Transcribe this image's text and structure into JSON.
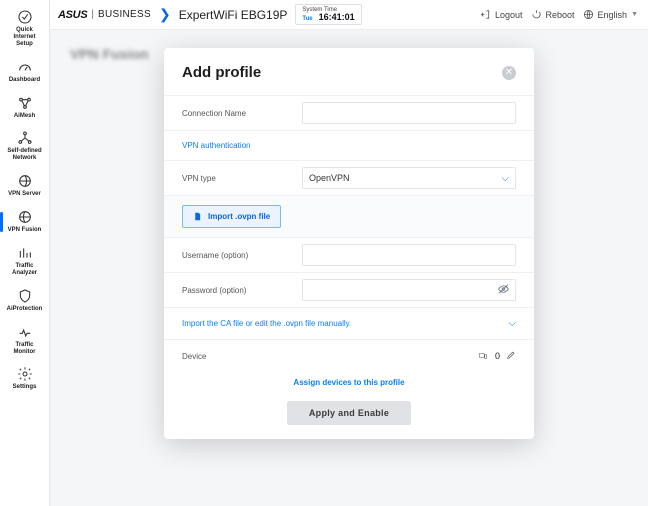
{
  "brand": {
    "asus": "ASUS",
    "biz": "BUSINESS",
    "model": "ExpertWiFi EBG19P"
  },
  "systime": {
    "label": "System Time",
    "day": "Tue",
    "clock": "16:41:01"
  },
  "topbar": {
    "logout": "Logout",
    "reboot": "Reboot",
    "language": "English"
  },
  "sidebar": {
    "items": [
      {
        "label": "Quick\nInternet\nSetup"
      },
      {
        "label": "Dashboard"
      },
      {
        "label": "AiMesh"
      },
      {
        "label": "Self-defined\nNetwork"
      },
      {
        "label": "VPN Server"
      },
      {
        "label": "VPN Fusion"
      },
      {
        "label": "Traffic\nAnalyzer"
      },
      {
        "label": "AiProtection"
      },
      {
        "label": "Traffic\nMonitor"
      },
      {
        "label": "Settings"
      }
    ],
    "activeIndex": 5
  },
  "bg": {
    "title": "VPN Fusion"
  },
  "modal": {
    "title": "Add profile",
    "connectionName": {
      "label": "Connection Name",
      "value": ""
    },
    "vpnAuthLink": "VPN authentication",
    "vpnType": {
      "label": "VPN type",
      "value": "OpenVPN"
    },
    "importBtn": "Import .ovpn file",
    "username": {
      "label": "Username (option)",
      "value": ""
    },
    "password": {
      "label": "Password (option)",
      "value": ""
    },
    "caLink": "Import the CA file or edit the .ovpn file manually.",
    "device": {
      "label": "Device",
      "count": "0"
    },
    "assignLink": "Assign devices to this profile",
    "applyBtn": "Apply and Enable"
  }
}
